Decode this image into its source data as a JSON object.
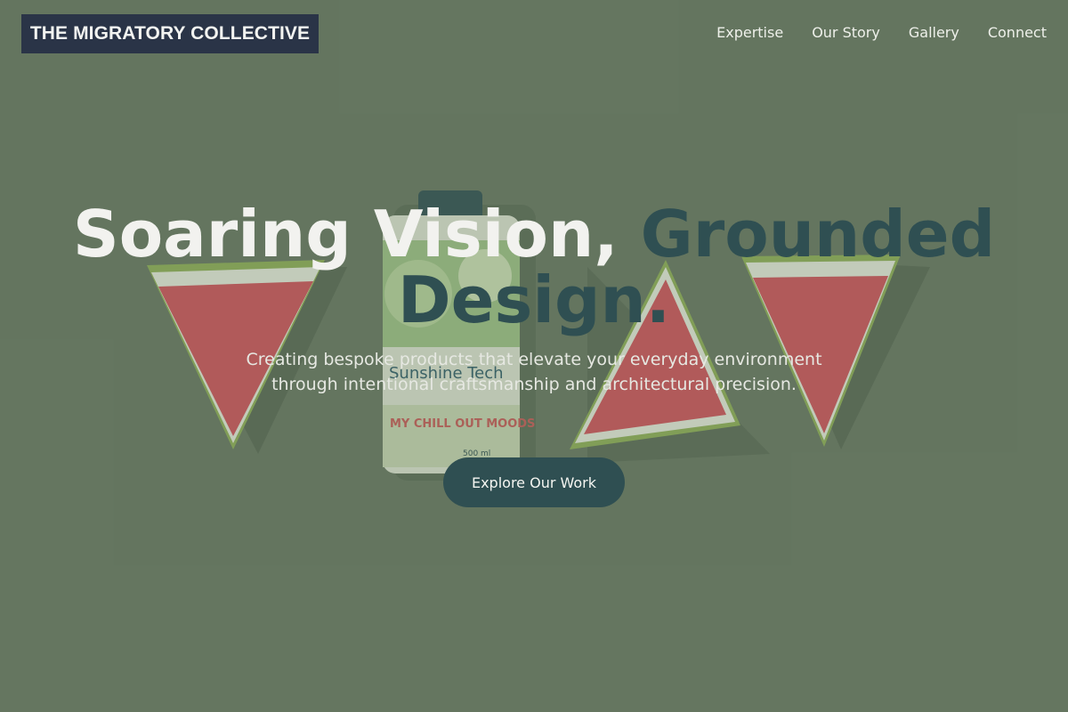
{
  "brand": {
    "name": "THE MIGRATORY COLLECTIVE"
  },
  "nav": {
    "items": [
      "Expertise",
      "Our Story",
      "Gallery",
      "Connect"
    ]
  },
  "hero": {
    "title_main": "Soaring Vision,",
    "title_accent": "Grounded Design.",
    "subtitle": "Creating bespoke products that elevate your everyday environment through intentional craftsmanship and architectural precision.",
    "cta_label": "Explore Our Work"
  },
  "background_image": {
    "package_brand": "Sunshine Tech",
    "package_tagline": "MY CHILL OUT MOODS",
    "package_volume": "500 ml"
  },
  "colors": {
    "page_bg": "#677862",
    "brand_bg": "#2a3447",
    "accent": "#2f4f52",
    "watermelon_flesh": "#d2525b",
    "watermelon_rind": "#8fb157"
  }
}
